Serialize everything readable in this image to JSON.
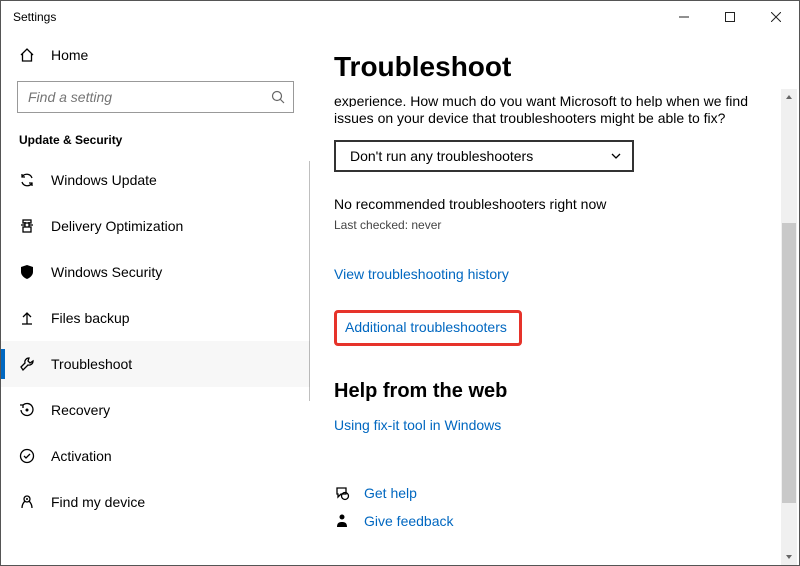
{
  "window": {
    "title": "Settings"
  },
  "sidebar": {
    "home_label": "Home",
    "search_placeholder": "Find a setting",
    "category_label": "Update & Security",
    "items": [
      {
        "id": "windows-update",
        "label": "Windows Update"
      },
      {
        "id": "delivery-optimization",
        "label": "Delivery Optimization"
      },
      {
        "id": "windows-security",
        "label": "Windows Security"
      },
      {
        "id": "files-backup",
        "label": "Files backup"
      },
      {
        "id": "troubleshoot",
        "label": "Troubleshoot"
      },
      {
        "id": "recovery",
        "label": "Recovery"
      },
      {
        "id": "activation",
        "label": "Activation"
      },
      {
        "id": "find-my-device",
        "label": "Find my device"
      }
    ],
    "selected_index": 4
  },
  "main": {
    "heading": "Troubleshoot",
    "partial_top_line": "experience. How much do you want Microsoft to help when we find",
    "partial_next_line": "issues on your device that troubleshooters might be able to fix?",
    "dropdown_value": "Don't run any troubleshooters",
    "status": "No recommended troubleshooters right now",
    "last_checked": "Last checked: never",
    "link_history": "View troubleshooting history",
    "link_additional": "Additional troubleshooters",
    "help_heading": "Help from the web",
    "link_fixit": "Using fix-it tool in Windows",
    "link_get_help": "Get help",
    "link_give_feedback": "Give feedback"
  }
}
